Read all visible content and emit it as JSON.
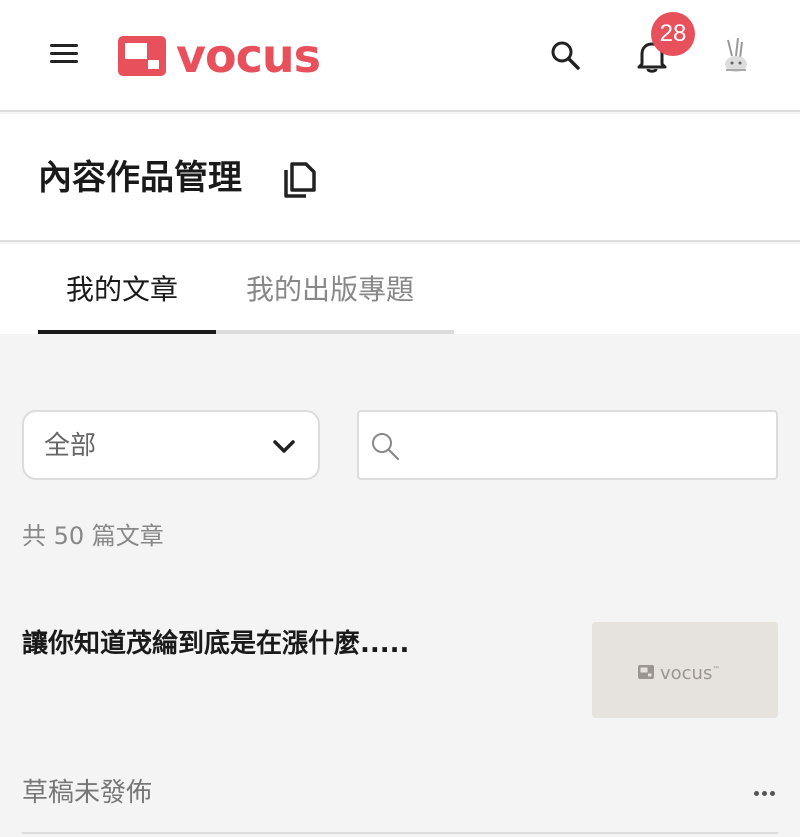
{
  "header": {
    "logo_text": "vocus",
    "notification_count": "28",
    "brand_color": "#e8505b",
    "icons": [
      "menu-icon",
      "search-icon",
      "bell-icon",
      "avatar"
    ]
  },
  "page": {
    "title": "內容作品管理"
  },
  "tabs": [
    {
      "label": "我的文章",
      "active": true
    },
    {
      "label": "我的出版專題",
      "active": false
    }
  ],
  "filter": {
    "selected": "全部"
  },
  "search": {
    "placeholder": "",
    "value": ""
  },
  "summary": {
    "count_text": "共 50 篇文章"
  },
  "articles": [
    {
      "title": "讓你知道茂綸到底是在漲什麼.....",
      "thumbnail_text": "vocus",
      "thumbnail_tm": "™",
      "status": "草稿未發佈"
    }
  ]
}
